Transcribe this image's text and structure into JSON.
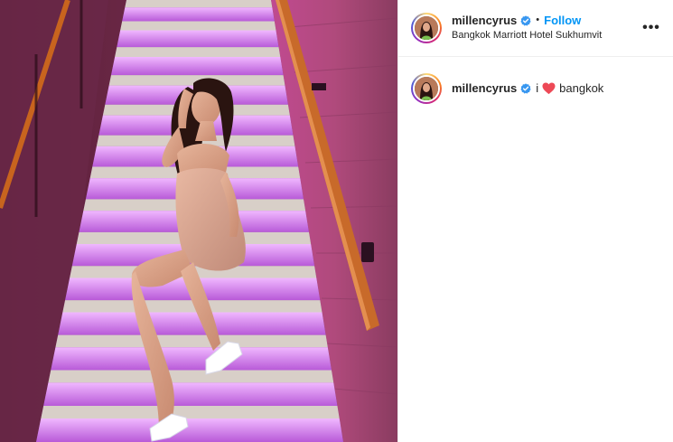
{
  "post": {
    "username": "millencyrus",
    "verified": true,
    "follow_separator": "•",
    "follow_label": "Follow",
    "location": "Bangkok Marriott Hotel Sukhumvit",
    "more_label": "•••",
    "caption": {
      "prefix": "i",
      "emoji": "heart-icon",
      "suffix": "bangkok"
    }
  },
  "colors": {
    "follow": "#0095f6",
    "verified": "#3897f0",
    "heart": "#ed4956",
    "stair_light": "#d070e8"
  },
  "icons": {
    "verified": "verified-badge-icon",
    "more": "more-options-icon",
    "heart": "heart-icon"
  }
}
